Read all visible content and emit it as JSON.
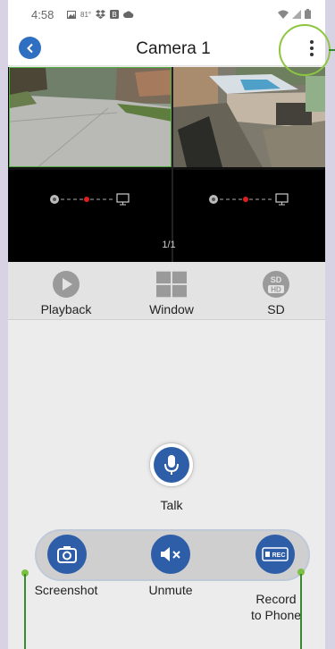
{
  "status_bar": {
    "time": "4:58",
    "temperature": "81°"
  },
  "header": {
    "title": "Camera 1"
  },
  "video": {
    "page_indicator": "1/1"
  },
  "toolbar": {
    "playback_label": "Playback",
    "window_label": "Window",
    "sd_label": "SD"
  },
  "talk": {
    "label": "Talk"
  },
  "actions": {
    "screenshot_label": "Screenshot",
    "unmute_label": "Unmute",
    "record_label_line1": "Record",
    "record_label_line2": "to Phone",
    "rec_icon_text": "REC"
  },
  "colors": {
    "accent_blue": "#2f5ea8",
    "callout_green": "#8cc63f",
    "live_dot_red": "#e02020"
  },
  "icons": [
    "back-icon",
    "more-vert-icon",
    "play-icon",
    "grid-icon",
    "sd-hd-icon",
    "microphone-icon",
    "camera-icon",
    "speaker-mute-icon",
    "rec-icon",
    "webcam-icon",
    "monitor-icon"
  ]
}
